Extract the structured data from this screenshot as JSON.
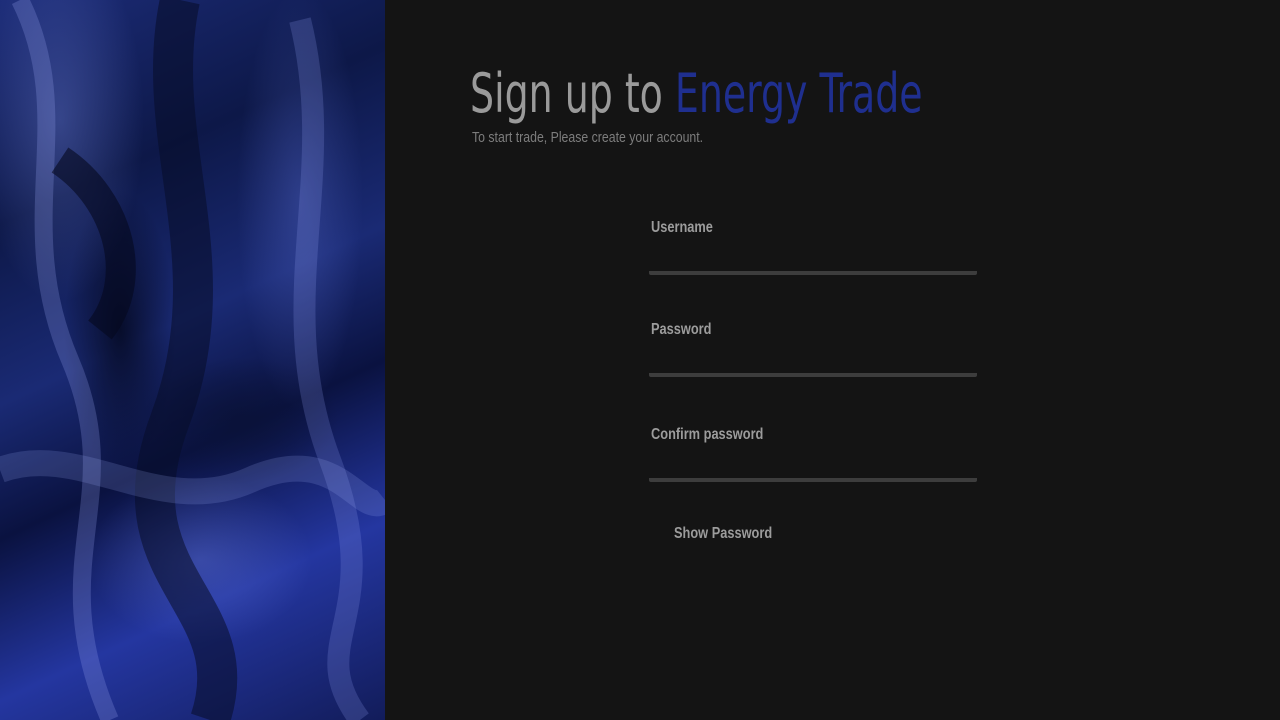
{
  "header": {
    "title_prefix": "Sign up to ",
    "title_brand": "Energy Trade",
    "subtitle": "To start trade, Please create your account."
  },
  "form": {
    "username": {
      "label": "Username",
      "value": ""
    },
    "password": {
      "label": "Password",
      "value": ""
    },
    "confirm_password": {
      "label": "Confirm password",
      "value": ""
    },
    "show_password_label": "Show Password"
  },
  "colors": {
    "background": "#141414",
    "brand": "#1f2f8f",
    "text_muted": "#9a9a9a",
    "field_underline": "#3d3d3d"
  }
}
